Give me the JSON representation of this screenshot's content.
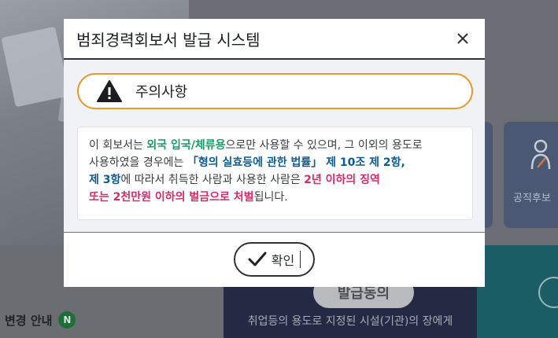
{
  "background": {
    "notice_label": "변경 안내",
    "notice_badge": "N",
    "navy_card_button": "발급동의",
    "navy_card_desc": "취업등의 용도로 지정된 시설(기관)의 장에게",
    "tile_label": "공직후보"
  },
  "modal": {
    "title": "범죄경력회보서 발급 시스템",
    "warning_title": "주의사항",
    "message": {
      "p1": "이 회보서는 ",
      "p2": "외국 입국/체류용",
      "p3": "으로만 사용할 수 있으며, 그 이외의 용도로",
      "p4": "사용하였을 경우에는 ",
      "p5": "「형의 실효등에 관한 법률」 제 10조 제 2항,",
      "p6": "제 3항",
      "p7": "에 따라서 취득한 사람과 사용한 사람은 ",
      "p8": "2년 이하의 징역",
      "p9": "또는 2천만원 이하의 벌금으로 처벌",
      "p10": "됩니다."
    },
    "ok_label": "확인"
  },
  "colors": {
    "warning_border": "#e79a2e",
    "highlight_green": "#1a9c68",
    "highlight_blue": "#0d5b94",
    "highlight_pink": "#d62a6b"
  },
  "icons": [
    "warning-icon",
    "close-icon",
    "check-icon",
    "person-icon"
  ]
}
